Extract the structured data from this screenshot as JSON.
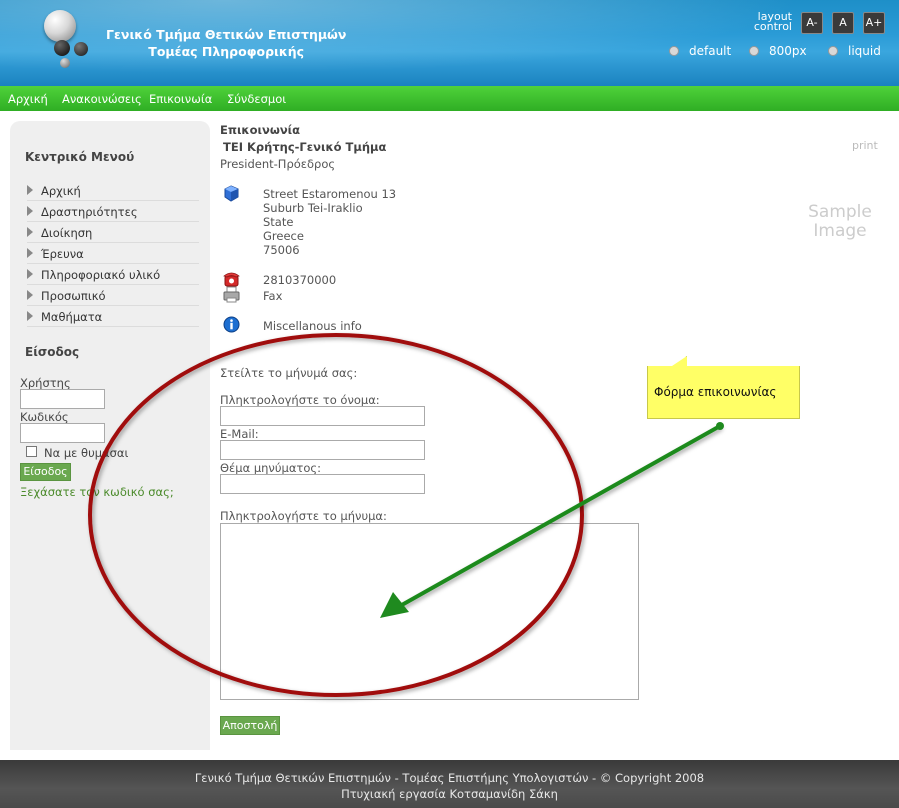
{
  "header": {
    "title_line1": "Γενικό Τμήμα Θετικών Επιστημών",
    "title_line2": "Τομέας Πληροφορικής",
    "layout_control_line1": "layout",
    "layout_control_line2": "control",
    "font_buttons": [
      "A-",
      "A",
      "A+"
    ],
    "layout_options": [
      "default",
      "800px",
      "liquid"
    ]
  },
  "nav": {
    "items": [
      "Αρχική",
      "Ανακοινώσεις",
      "Επικοινωία",
      "Σύνδεσμοι"
    ]
  },
  "sidebar": {
    "menu_heading": "Κεντρικό Μενού",
    "menu_items": [
      "Αρχική",
      "Δραστηριότητες",
      "Διοίκηση",
      "Έρευνα",
      "Πληροφοριακό υλικό",
      "Προσωπικό",
      "Μαθήματα"
    ],
    "login_heading": "Είσοδος",
    "username_label": "Χρήστης",
    "password_label": "Κωδικός",
    "remember_label": "Να με θυμάσαι",
    "login_button": "Είσοδος",
    "forgot_link": "Ξεχάσατε τον κωδικό σας;"
  },
  "content": {
    "title": "Επικοινωνία",
    "org": "ΤΕΙ Κρήτης-Γενικό Τμήμα",
    "role": "President-Πρόεδρος",
    "print_label": "print",
    "sample_line1": "Sample",
    "sample_line2": "Image",
    "address": [
      "Street Estaromenou 13",
      "Suburb Tei-Iraklio",
      "State",
      "Greece",
      "75006"
    ],
    "phone": "2810370000",
    "fax": "Fax",
    "misc": "Miscellanous info",
    "form_intro": "Στείλτε το μήνυμά σας:",
    "name_label": "Πληκτρολογήστε το όνομα:",
    "email_label": "E-Mail:",
    "subject_label": "Θέμα μηνύματος:",
    "message_label": "Πληκτρολογήστε το μήνυμα:",
    "send_button": "Αποστολή"
  },
  "annotation": {
    "note_text": "Φόρμα επικοινωνίας",
    "ellipse_color": "#a01010",
    "arrow_color": "#1f8a1f"
  },
  "footer": {
    "line1": "Γενικό Τμήμα Θετικών Επιστημών - Τομέας Επιστήμης Υπολογιστών - © Copyright 2008",
    "line2": "Πτυχιακή εργασία Κοτσαμανίδη Σάκη"
  },
  "colors": {
    "header_blue": "#2a9bd6",
    "nav_green": "#3dbf2d",
    "button_green": "#6aa84f",
    "footer_gray": "#4a4a4a"
  }
}
